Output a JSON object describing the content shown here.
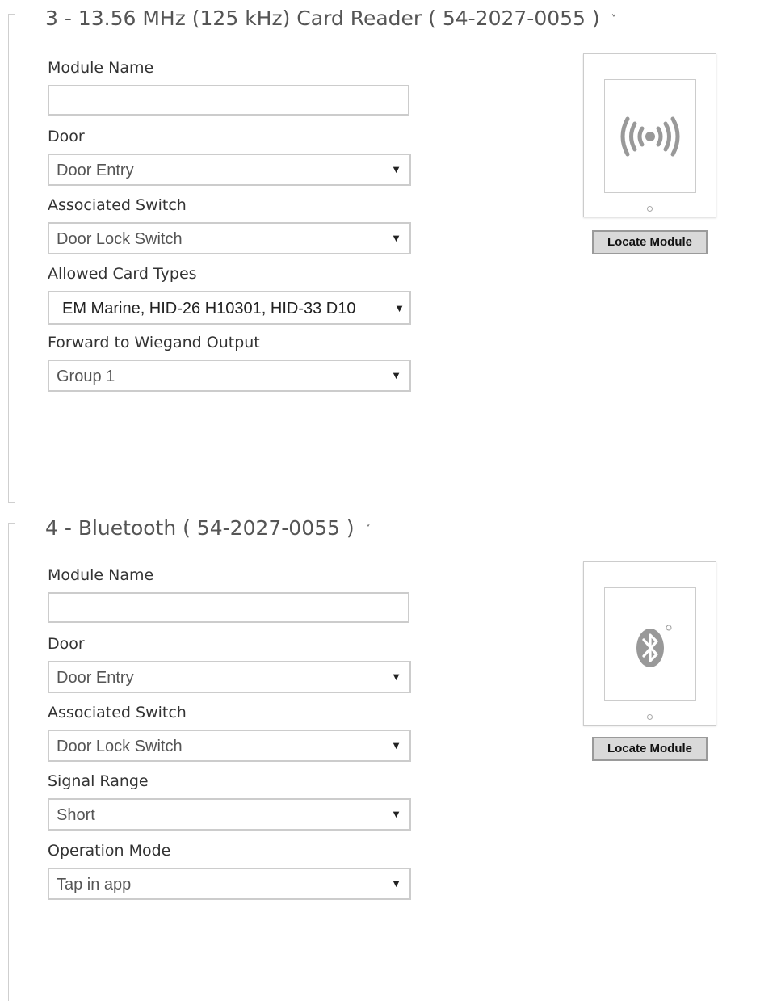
{
  "sections": [
    {
      "title": "3 - 13.56 MHz (125 kHz) Card Reader ( 54-2027-0055 )",
      "chevron_icon": "chevron-down-icon",
      "module_name_label": "Module Name",
      "module_name_value": "",
      "door_label": "Door",
      "door_value": "Door Entry",
      "switch_label": "Associated Switch",
      "switch_value": "Door Lock Switch",
      "card_types_label": "Allowed Card Types",
      "card_types_value": "EM Marine, HID-26 H10301, HID-33 D10",
      "wiegand_label": "Forward to Wiegand Output",
      "wiegand_value": "Group 1",
      "module_icon": "rfid-wave-icon",
      "locate_label": "Locate Module"
    },
    {
      "title": "4 - Bluetooth ( 54-2027-0055 )",
      "chevron_icon": "chevron-down-icon",
      "module_name_label": "Module Name",
      "module_name_value": "",
      "door_label": "Door",
      "door_value": "Door Entry",
      "switch_label": "Associated Switch",
      "switch_value": "Door Lock Switch",
      "signal_label": "Signal Range",
      "signal_value": "Short",
      "operation_label": "Operation Mode",
      "operation_value": "Tap in app",
      "module_icon": "bluetooth-icon",
      "locate_label": "Locate Module"
    }
  ],
  "select_arrow": "▼",
  "chevron_glyph": "˅"
}
